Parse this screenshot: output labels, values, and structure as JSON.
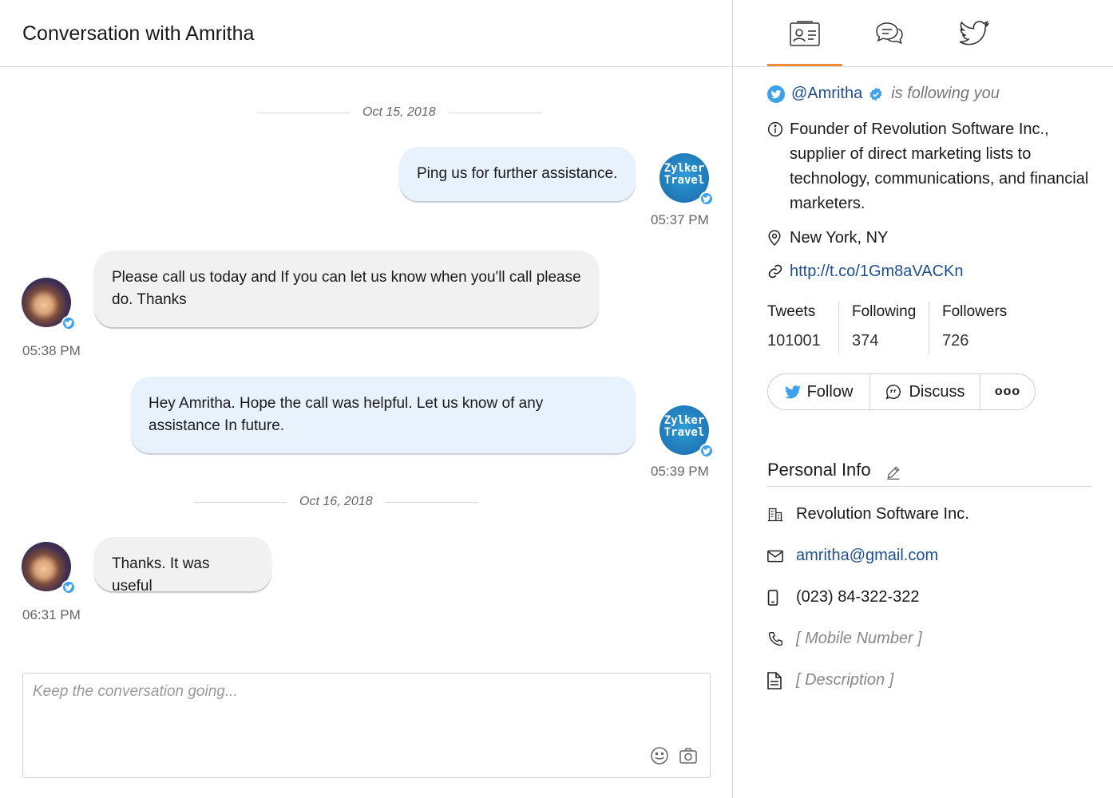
{
  "conversation": {
    "title": "Conversation with Amritha",
    "brand_avatar_text": "Zylker Travel",
    "messages": [
      {
        "date_separator": "Oct 15, 2018"
      },
      {
        "direction": "outgoing",
        "text": "Ping us for further assistance.",
        "time": "05:37 PM"
      },
      {
        "direction": "incoming",
        "text": "Please call us today and If you can let us know when you'll call please do. Thanks",
        "time": "05:38 PM"
      },
      {
        "direction": "outgoing",
        "text": "Hey Amritha. Hope the call was helpful. Let us know of any assistance In future.",
        "time": "05:39 PM"
      },
      {
        "date_separator": "Oct 16, 2018"
      },
      {
        "direction": "incoming",
        "text": "Thanks. It was useful",
        "time": "06:31 PM"
      }
    ],
    "composer_placeholder": "Keep the conversation going..."
  },
  "profile": {
    "tabs": [
      "contact-card-icon",
      "chat-bubbles-icon",
      "twitter-bird-icon"
    ],
    "handle": "@Amritha",
    "following_text": "is following you",
    "bio": "Founder of Revolution Software Inc., supplier of direct marketing lists to technology, communications, and financial marketers.",
    "location": "New York, NY",
    "url": "http://t.co/1Gm8aVACKn",
    "stats": [
      {
        "label": "Tweets",
        "value": "101001"
      },
      {
        "label": "Following",
        "value": "374"
      },
      {
        "label": "Followers",
        "value": "726"
      }
    ],
    "buttons": {
      "follow": "Follow",
      "discuss": "Discuss",
      "more": "ooo"
    },
    "personal_info": {
      "title": "Personal Info",
      "company": "Revolution Software Inc.",
      "email": "amritha@gmail.com",
      "phone": "(023) 84-322-322",
      "mobile": "[ Mobile Number ]",
      "description": "[ Description ]"
    }
  },
  "colors": {
    "accent": "#f28c38",
    "link": "#1d4f91",
    "twitter": "#3ea1ec",
    "outgoing_bubble": "#e8f2fd",
    "incoming_bubble": "#f1f1f1"
  }
}
